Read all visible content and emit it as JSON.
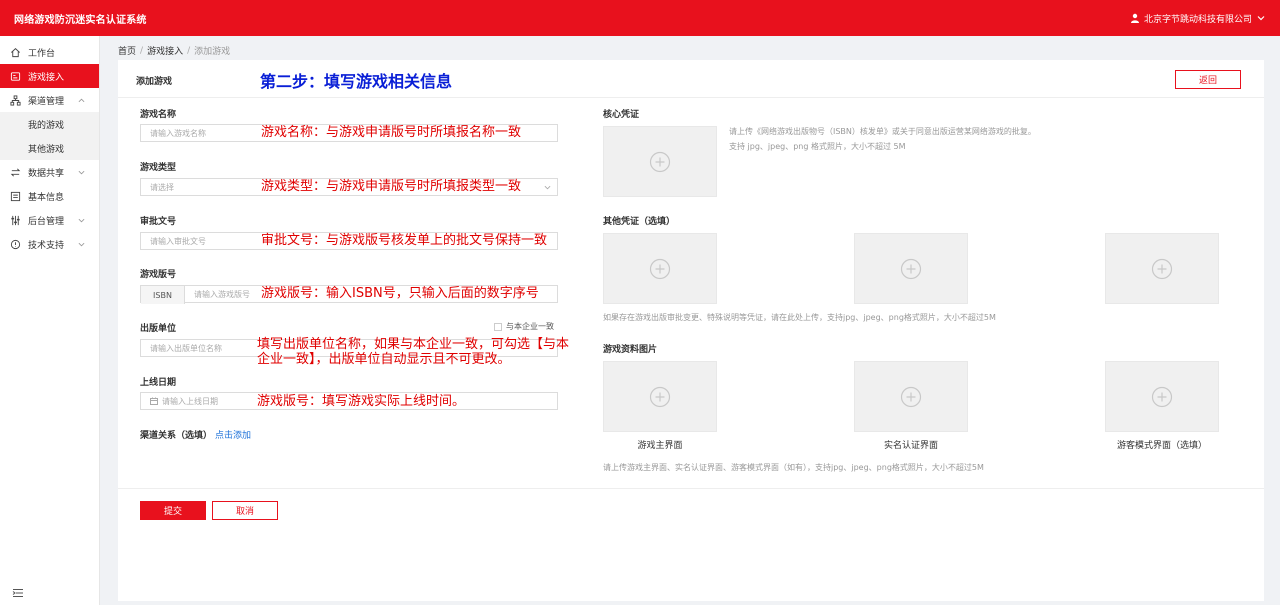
{
  "app": {
    "title": "网络游戏防沉迷实名认证系统",
    "user": "北京字节跳动科技有限公司"
  },
  "sidebar": {
    "items": [
      {
        "label": "工作台",
        "icon": "home-icon"
      },
      {
        "label": "游戏接入",
        "icon": "gamepad-icon"
      },
      {
        "label": "渠道管理",
        "icon": "channel-icon"
      },
      {
        "label": "我的游戏"
      },
      {
        "label": "其他游戏"
      },
      {
        "label": "数据共享",
        "icon": "share-icon"
      },
      {
        "label": "基本信息",
        "icon": "info-icon"
      },
      {
        "label": "后台管理",
        "icon": "sliders-icon"
      },
      {
        "label": "技术支持",
        "icon": "support-icon"
      }
    ]
  },
  "breadcrumb": [
    "首页",
    "游戏接入",
    "添加游戏"
  ],
  "card": {
    "title": "添加游戏",
    "step": "第二步：填写游戏相关信息",
    "back": "返回"
  },
  "form": {
    "name": {
      "label": "游戏名称",
      "placeholder": "请输入游戏名称",
      "note": "游戏名称：与游戏申请版号时所填报名称一致"
    },
    "type": {
      "label": "游戏类型",
      "placeholder": "请选择",
      "note": "游戏类型：与游戏申请版号时所填报类型一致"
    },
    "approval": {
      "label": "审批文号",
      "placeholder": "请输入审批文号",
      "note": "审批文号：与游戏版号核发单上的批文号保持一致"
    },
    "version": {
      "label": "游戏版号",
      "prefix": "ISBN",
      "placeholder": "请输入游戏版号",
      "note": "游戏版号：输入ISBN号，只输入后面的数字序号"
    },
    "publisher": {
      "label": "出版单位",
      "checkbox": "与本企业一致",
      "placeholder": "请输入出版单位名称",
      "note": "填写出版单位名称，如果与本企业一致，可勾选【与本企业一致】，出版单位自动显示且不可更改。"
    },
    "launch": {
      "label": "上线日期",
      "placeholder": "请输入上线日期",
      "note": "游戏版号：填写游戏实际上线时间。"
    },
    "channel": {
      "label": "渠道关系（选填）",
      "link": "点击添加"
    }
  },
  "right": {
    "core": {
      "label": "核心凭证",
      "hint1": "请上传《网络游戏出版物号（ISBN）核发单》或关于同意出版运营某网络游戏的批复。",
      "hint2": "支持 jpg、jpeg、png 格式照片，大小不超过 5M"
    },
    "other": {
      "label": "其他凭证（选填）",
      "hint": "如果存在游戏出版审批变更、特殊说明等凭证，请在此处上传，支持jpg、jpeg、png格式照片，大小不超过5M"
    },
    "images": {
      "label": "游戏资料图片",
      "captions": [
        "游戏主界面",
        "实名认证界面",
        "游客模式界面（选填）"
      ],
      "hint": "请上传游戏主界面、实名认证界面、游客模式界面（如有），支持jpg、jpeg、png格式照片，大小不超过5M"
    }
  },
  "actions": {
    "submit": "提交",
    "cancel": "取消"
  },
  "colors": {
    "brand": "#e8111d",
    "step": "#0a1fd6",
    "link": "#1a6fd8",
    "annotation": "#e00000"
  }
}
